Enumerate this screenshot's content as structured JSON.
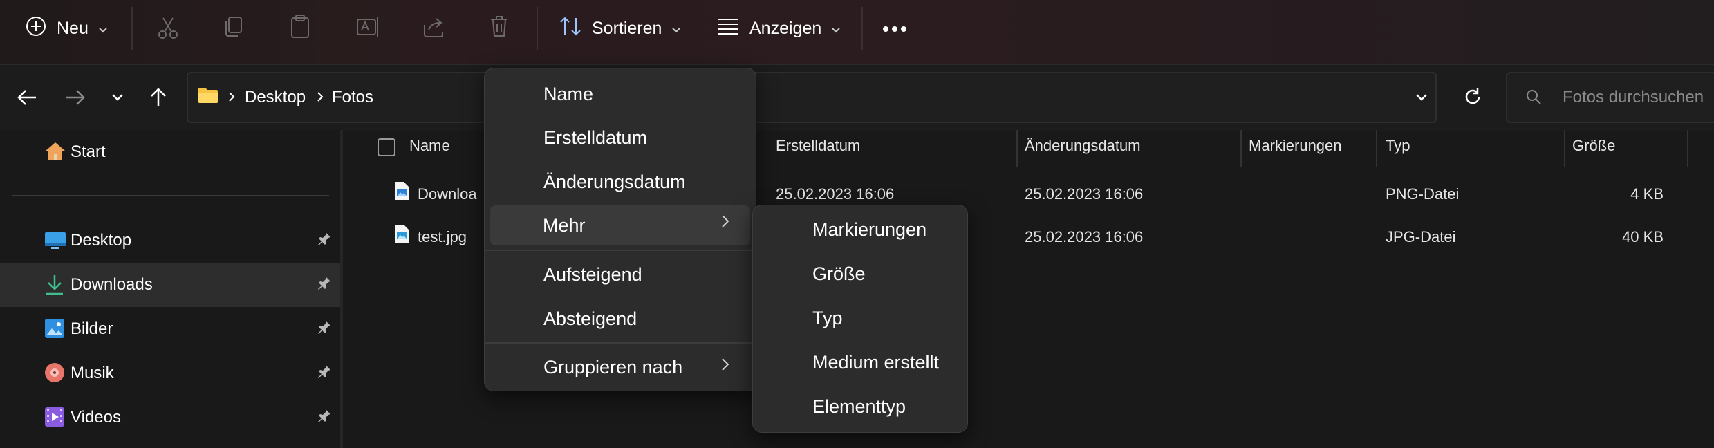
{
  "toolbar": {
    "new_label": "Neu",
    "sort_label": "Sortieren",
    "view_label": "Anzeigen"
  },
  "address": {
    "breadcrumb": [
      "Desktop",
      "Fotos"
    ],
    "search_placeholder": "Fotos durchsuchen"
  },
  "sidebar": {
    "home": "Start",
    "items": [
      {
        "label": "Desktop",
        "pinned": true
      },
      {
        "label": "Downloads",
        "pinned": true,
        "selected": true
      },
      {
        "label": "Bilder",
        "pinned": true
      },
      {
        "label": "Musik",
        "pinned": true
      },
      {
        "label": "Videos",
        "pinned": true
      }
    ]
  },
  "columns": {
    "name": "Name",
    "created": "Erstelldatum",
    "modified": "Änderungsdatum",
    "tags": "Markierungen",
    "type": "Typ",
    "size": "Größe"
  },
  "files": [
    {
      "name": "Downloa",
      "created": "25.02.2023 16:06",
      "modified": "25.02.2023 16:06",
      "type": "PNG-Datei",
      "size": "4 KB"
    },
    {
      "name": "test.jpg",
      "created": "",
      "modified": "25.02.2023 16:06",
      "type": "JPG-Datei",
      "size": "40 KB"
    }
  ],
  "sort_menu": {
    "items": [
      "Name",
      "Erstelldatum",
      "Änderungsdatum",
      "Mehr",
      "Aufsteigend",
      "Absteigend",
      "Gruppieren nach"
    ]
  },
  "more_submenu": {
    "items": [
      "Markierungen",
      "Größe",
      "Typ",
      "Medium erstellt",
      "Elementtyp"
    ]
  },
  "colors": {
    "background": "#191919",
    "menu": "#2c2c2c",
    "folder": "#f5c542",
    "accent_green": "#3fbf8f"
  }
}
